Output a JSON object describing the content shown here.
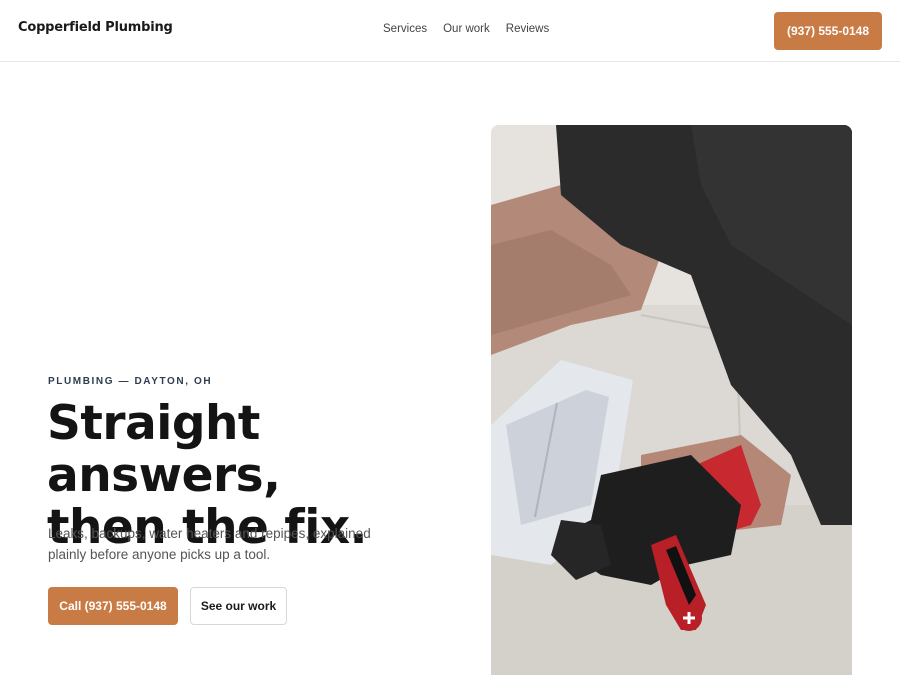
{
  "header": {
    "brand": "Copperfield Plumbing",
    "nav": [
      "Services",
      "Our work",
      "Reviews"
    ],
    "cta_label": "(937) 555-0148"
  },
  "hero": {
    "eyebrow": "PLUMBING — DAYTON, OH",
    "headline_line1": "Straight answers,",
    "headline_line2": "then the fix.",
    "lede": "Leaks, backups, water heaters and repipes, explained plainly before anyone picks up a tool.",
    "primary_label": "Call (937) 555-0148",
    "secondary_label": "See our work"
  },
  "colors": {
    "accent": "#c97b45",
    "eyebrow": "#2d3e50",
    "text": "#141414"
  }
}
